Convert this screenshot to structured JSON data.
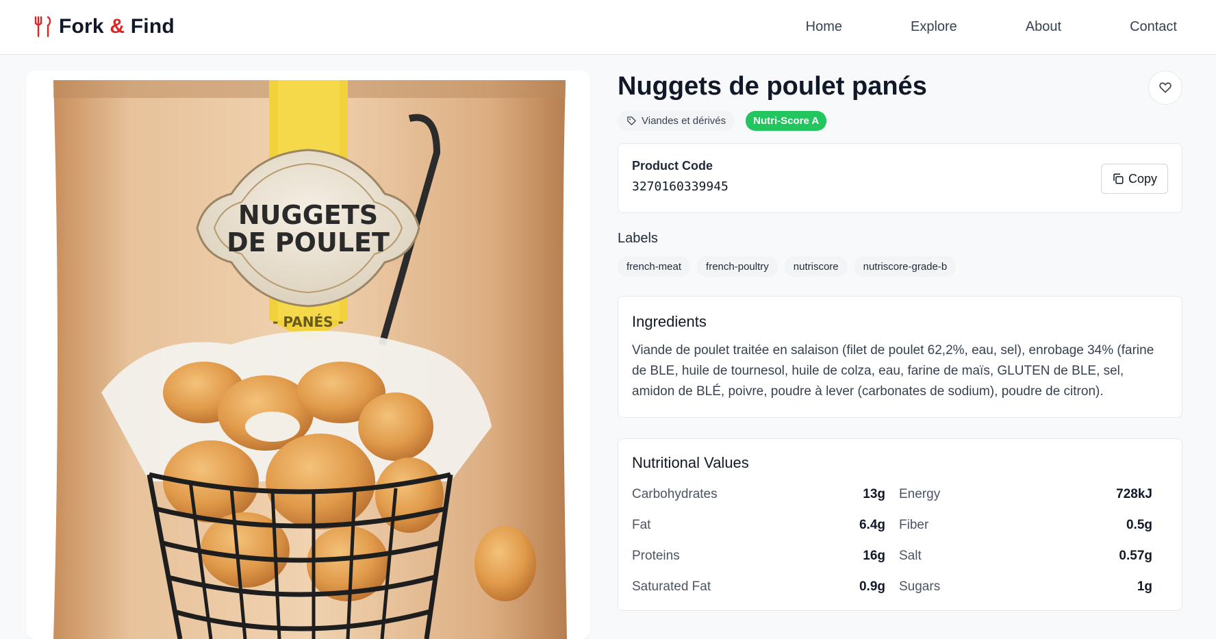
{
  "brand": {
    "name_part1": "Fork",
    "amp": "&",
    "name_part2": "Find"
  },
  "nav": [
    "Home",
    "Explore",
    "About",
    "Contact"
  ],
  "product": {
    "title": "Nuggets de poulet panés",
    "category": "Viandes et dérivés",
    "nutri_score": "Nutri-Score A",
    "image_text_line1": "NUGGETS",
    "image_text_line2": "DE POULET",
    "image_text_line3": "- PANÉS -"
  },
  "code": {
    "label": "Product Code",
    "value": "3270160339945",
    "copy_label": "Copy"
  },
  "labels": {
    "title": "Labels",
    "items": [
      "french-meat",
      "french-poultry",
      "nutriscore",
      "nutriscore-grade-b"
    ]
  },
  "ingredients": {
    "title": "Ingredients",
    "text": "Viande de poulet traitée en salaison (filet de poulet 62,2%, eau, sel), enrobage 34% (farine de BLE, huile de tournesol, huile de colza, eau, farine de maïs, GLUTEN de BLE, sel, amidon de BLÉ, poivre, poudre à lever (carbonates de sodium), poudre de citron)."
  },
  "nutrition": {
    "title": "Nutritional Values",
    "left": [
      {
        "name": "Carbohydrates",
        "value": "13g"
      },
      {
        "name": "Fat",
        "value": "6.4g"
      },
      {
        "name": "Proteins",
        "value": "16g"
      },
      {
        "name": "Saturated Fat",
        "value": "0.9g"
      }
    ],
    "right": [
      {
        "name": "Energy",
        "value": "728kJ"
      },
      {
        "name": "Fiber",
        "value": "0.5g"
      },
      {
        "name": "Salt",
        "value": "0.57g"
      },
      {
        "name": "Sugars",
        "value": "1g"
      }
    ]
  },
  "colors": {
    "accent": "#dc2626",
    "nutri": "#22c55e",
    "text": "#111827"
  }
}
